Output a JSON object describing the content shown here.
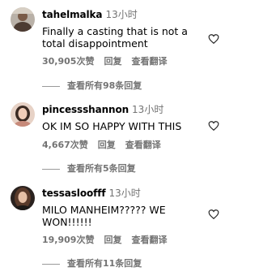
{
  "comments": [
    {
      "username": "tahelmalka",
      "time": "13小时",
      "text": "Finally a casting that is not a total disappointment",
      "likes": "30,905次赞",
      "reply": "回复",
      "translate": "查看翻译",
      "view_replies": "查看所有98条回复"
    },
    {
      "username": "pincessshannon",
      "time": "13小时",
      "text": "OK IM SO HAPPY WITH THIS",
      "likes": "4,667次赞",
      "reply": "回复",
      "translate": "查看翻译",
      "view_replies": "查看所有5条回复"
    },
    {
      "username": "tessasloofff",
      "time": "13小时",
      "text": "MILO MANHEIM????? WE WON!!!!!!",
      "likes": "19,909次赞",
      "reply": "回复",
      "translate": "查看翻译",
      "view_replies": "查看所有11条回复"
    }
  ],
  "icons": {
    "like": "heart-icon"
  },
  "colors": {
    "secondary_text": "#737373",
    "primary_text": "#000000"
  }
}
